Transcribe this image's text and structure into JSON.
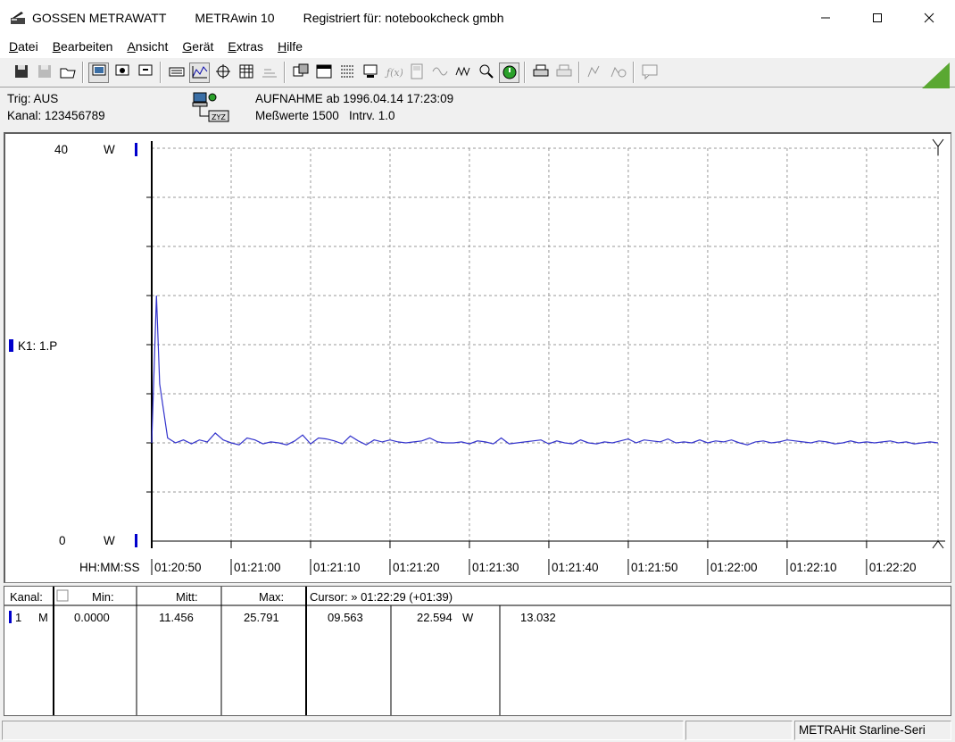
{
  "window": {
    "company": "GOSSEN METRAWATT",
    "app_name": "METRAwin 10",
    "registration": "Registriert für: notebookcheck gmbh"
  },
  "menu": [
    {
      "label": "Datei",
      "accel": "D",
      "rest": "atei"
    },
    {
      "label": "Bearbeiten",
      "accel": "B",
      "rest": "earbeiten"
    },
    {
      "label": "Ansicht",
      "accel": "A",
      "rest": "nsicht"
    },
    {
      "label": "Gerät",
      "accel": "G",
      "rest": "erät"
    },
    {
      "label": "Extras",
      "accel": "E",
      "rest": "xtras"
    },
    {
      "label": "Hilfe",
      "accel": "H",
      "rest": "ilfe"
    }
  ],
  "toolbar_icons": [
    "save-icon",
    "save-disabled-icon",
    "open-folder-icon",
    "monitor-icon",
    "monitor-settings-icon",
    "monitor-arrow-icon",
    "keyboard-icon",
    "graph-mode-icon",
    "crosshair-icon",
    "table-icon",
    "list-graph-icon",
    "copy-window-icon",
    "window-list-icon",
    "data-list-icon",
    "computer-icon",
    "function-icon",
    "device-icon",
    "wave-icon",
    "wave2-icon",
    "zoom-settings-icon",
    "stopwatch-icon",
    "print-icon",
    "print-preview-icon",
    "measure-icon",
    "measure-zoom-icon",
    "comment-icon"
  ],
  "info": {
    "trigger": "Trig: AUS",
    "channel": "Kanal: 123456789",
    "recording": "AUFNAHME ab 1996.04.14 17:23:09",
    "measurements": "Meßwerte 1500   Intrv. 1.0"
  },
  "chart_data": {
    "type": "line",
    "ylim": [
      0,
      40
    ],
    "y_top_label": "40",
    "y_bottom_label": "0",
    "y_unit_top": "W",
    "y_unit_bottom": "W",
    "channel_label": "K1: 1.P",
    "x_axis_format": "HH:MM:SS",
    "x_tick_labels": [
      "01:20:50",
      "01:21:00",
      "01:21:10",
      "01:21:20",
      "01:21:30",
      "01:21:40",
      "01:21:50",
      "01:22:00",
      "01:22:10",
      "01:22:20"
    ],
    "x_tick_seconds": [
      0,
      10,
      20,
      30,
      40,
      50,
      60,
      70,
      80,
      90
    ],
    "x_range_seconds": [
      0,
      99
    ],
    "series": [
      {
        "color": "#3333cc",
        "points": [
          [
            0,
            10
          ],
          [
            0.6,
            25
          ],
          [
            1,
            16
          ],
          [
            2,
            10.5
          ],
          [
            3,
            10
          ],
          [
            4,
            10.3
          ],
          [
            5,
            9.9
          ],
          [
            6,
            10.3
          ],
          [
            7,
            10.1
          ],
          [
            8,
            11
          ],
          [
            9,
            10.3
          ],
          [
            10,
            10
          ],
          [
            11,
            9.8
          ],
          [
            12,
            10.5
          ],
          [
            13,
            10.3
          ],
          [
            14,
            9.9
          ],
          [
            15,
            10.1
          ],
          [
            16,
            10
          ],
          [
            17,
            9.8
          ],
          [
            18,
            10.2
          ],
          [
            19,
            10.8
          ],
          [
            20,
            9.9
          ],
          [
            21,
            10.5
          ],
          [
            22,
            10.4
          ],
          [
            23,
            10.2
          ],
          [
            24,
            9.9
          ],
          [
            25,
            10.7
          ],
          [
            26,
            10.2
          ],
          [
            27,
            9.8
          ],
          [
            28,
            10.3
          ],
          [
            29,
            10.1
          ],
          [
            30,
            10.3
          ],
          [
            31,
            10.1
          ],
          [
            32,
            10
          ],
          [
            33,
            10.1
          ],
          [
            34,
            10.2
          ],
          [
            35,
            10.5
          ],
          [
            36,
            10.1
          ],
          [
            37,
            10
          ],
          [
            38,
            10
          ],
          [
            39,
            10.1
          ],
          [
            40,
            9.9
          ],
          [
            41,
            10.2
          ],
          [
            42,
            10.1
          ],
          [
            43,
            9.9
          ],
          [
            44,
            10.5
          ],
          [
            45,
            9.9
          ],
          [
            46,
            10
          ],
          [
            47,
            10.1
          ],
          [
            48,
            10.2
          ],
          [
            49,
            10.3
          ],
          [
            50,
            9.9
          ],
          [
            51,
            10.2
          ],
          [
            52,
            10
          ],
          [
            53,
            9.9
          ],
          [
            54,
            10.3
          ],
          [
            55,
            10
          ],
          [
            56,
            9.9
          ],
          [
            57,
            10.1
          ],
          [
            58,
            10
          ],
          [
            59,
            10.2
          ],
          [
            60,
            10.4
          ],
          [
            61,
            10
          ],
          [
            62,
            10.3
          ],
          [
            63,
            10.2
          ],
          [
            64,
            10.1
          ],
          [
            65,
            10.4
          ],
          [
            66,
            10
          ],
          [
            67,
            10.1
          ],
          [
            68,
            10
          ],
          [
            69,
            10.3
          ],
          [
            70,
            10
          ],
          [
            71,
            10.2
          ],
          [
            72,
            10.1
          ],
          [
            73,
            10.3
          ],
          [
            74,
            10
          ],
          [
            75,
            9.8
          ],
          [
            76,
            10.1
          ],
          [
            77,
            10.2
          ],
          [
            78,
            10
          ],
          [
            79,
            10.1
          ],
          [
            80,
            10.3
          ],
          [
            81,
            10.2
          ],
          [
            82,
            10.1
          ],
          [
            83,
            10
          ],
          [
            84,
            10.2
          ],
          [
            85,
            10.1
          ],
          [
            86,
            9.9
          ],
          [
            87,
            10
          ],
          [
            88,
            10.2
          ],
          [
            89,
            10
          ],
          [
            90,
            10.1
          ],
          [
            91,
            10
          ],
          [
            92,
            10.1
          ],
          [
            93,
            10.2
          ],
          [
            94,
            10
          ],
          [
            95,
            10.1
          ],
          [
            96,
            9.9
          ],
          [
            97,
            10
          ],
          [
            98,
            10.1
          ],
          [
            99,
            10
          ]
        ]
      }
    ]
  },
  "table": {
    "headers": {
      "kanal": "Kanal:",
      "min": "Min:",
      "mitt": "Mitt:",
      "max": "Max:",
      "cursor": "Cursor: » 01:22:29 (+01:39)"
    },
    "row": {
      "channel": "1",
      "mode": "M",
      "min": "0.0000",
      "mitt": "11.456",
      "max": "25.791",
      "c1": "09.563",
      "c2": "22.594",
      "unit": "W",
      "c3": "13.032"
    }
  },
  "status": {
    "device": "METRAHit Starline-Seri"
  }
}
